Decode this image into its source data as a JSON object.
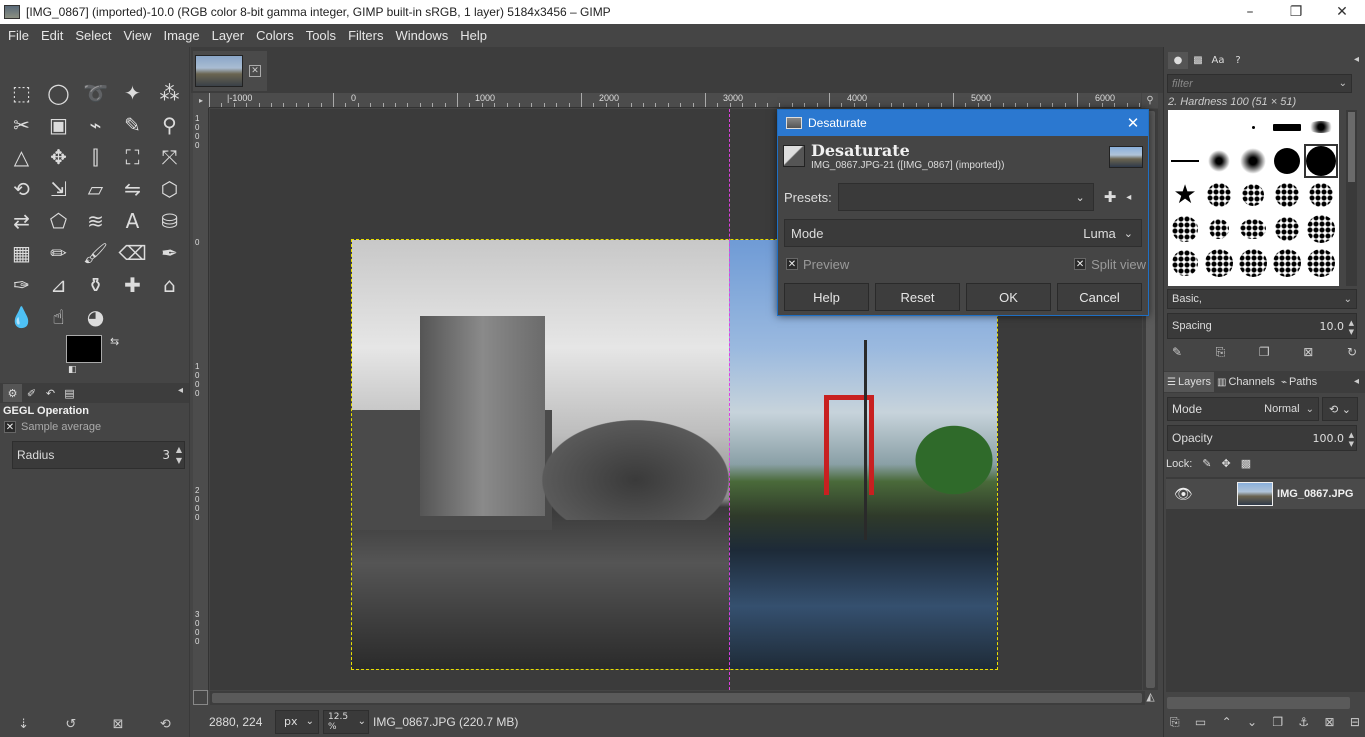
{
  "window": {
    "title": "[IMG_0867] (imported)-10.0 (RGB color 8-bit gamma integer, GIMP built-in sRGB, 1 layer) 5184x3456 – GIMP",
    "buttons": [
      "–",
      "❐",
      "✕"
    ]
  },
  "menu": [
    "File",
    "Edit",
    "Select",
    "View",
    "Image",
    "Layer",
    "Colors",
    "Tools",
    "Filters",
    "Windows",
    "Help"
  ],
  "toolbox": {
    "tools": [
      {
        "name": "rect-select-icon",
        "glyph": "⬚"
      },
      {
        "name": "ellipse-select-icon",
        "glyph": "◯"
      },
      {
        "name": "free-select-icon",
        "glyph": "➰"
      },
      {
        "name": "fuzzy-select-icon",
        "glyph": "✦"
      },
      {
        "name": "select-by-color-icon",
        "glyph": "⁂"
      },
      {
        "name": "scissors-select-icon",
        "glyph": "✂"
      },
      {
        "name": "foreground-select-icon",
        "glyph": "▣"
      },
      {
        "name": "paths-icon",
        "glyph": "⌁"
      },
      {
        "name": "color-picker-icon",
        "glyph": "✎"
      },
      {
        "name": "zoom-icon",
        "glyph": "⚲"
      },
      {
        "name": "measure-icon",
        "glyph": "△"
      },
      {
        "name": "move-icon",
        "glyph": "✥"
      },
      {
        "name": "align-icon",
        "glyph": "⫿"
      },
      {
        "name": "crop-icon",
        "glyph": "⛶"
      },
      {
        "name": "unified-transform-icon",
        "glyph": "⤧"
      },
      {
        "name": "rotate-icon",
        "glyph": "⟲"
      },
      {
        "name": "scale-icon",
        "glyph": "⇲"
      },
      {
        "name": "shear-icon",
        "glyph": "▱"
      },
      {
        "name": "flip-icon",
        "glyph": "⇋"
      },
      {
        "name": "perspective-icon",
        "glyph": "⬡"
      },
      {
        "name": "warp-transform-icon",
        "glyph": "⇄"
      },
      {
        "name": "cage-transform-icon",
        "glyph": "⬠"
      },
      {
        "name": "smudge-warp-icon",
        "glyph": "≋"
      },
      {
        "name": "text-icon",
        "glyph": "A"
      },
      {
        "name": "bucket-fill-icon",
        "glyph": "⛁"
      },
      {
        "name": "gradient-icon",
        "glyph": "▦"
      },
      {
        "name": "pencil-icon",
        "glyph": "✏"
      },
      {
        "name": "paintbrush-icon",
        "glyph": "🖌"
      },
      {
        "name": "eraser-icon",
        "glyph": "⌫"
      },
      {
        "name": "airbrush-icon",
        "glyph": "✒"
      },
      {
        "name": "ink-icon",
        "glyph": "✑"
      },
      {
        "name": "mypaint-brush-icon",
        "glyph": "⊿"
      },
      {
        "name": "clone-icon",
        "glyph": "⚱"
      },
      {
        "name": "heal-icon",
        "glyph": "✚"
      },
      {
        "name": "perspective-clone-icon",
        "glyph": "⌂"
      },
      {
        "name": "blur-icon",
        "glyph": "💧"
      },
      {
        "name": "smudge-icon",
        "glyph": "☝"
      },
      {
        "name": "dodge-burn-icon",
        "glyph": "◕"
      }
    ],
    "options_title": "GEGL Operation",
    "sample_average": "Sample average",
    "radius_label": "Radius",
    "radius_value": "3",
    "bottom_icons": [
      "⇣",
      "↺",
      "⊠",
      "⟲"
    ]
  },
  "rulers": {
    "h_labels": [
      "|-1000",
      "0",
      "1000",
      "2000",
      "3000",
      "4000",
      "5000",
      "6000"
    ],
    "v_labels": [
      "1000",
      "0",
      "1000",
      "2000",
      "3000"
    ]
  },
  "status": {
    "coords": "2880, 224",
    "unit": "px",
    "zoom": "12.5 %",
    "file": "IMG_0867.JPG (220.7 MB)"
  },
  "dialog": {
    "window_title": "Desaturate",
    "heading": "Desaturate",
    "subtitle": "IMG_0867.JPG-21 ([IMG_0867] (imported))",
    "presets_label": "Presets:",
    "presets_value": "",
    "mode_label": "Mode",
    "mode_value": "Luma",
    "preview_label": "Preview",
    "split_view_label": "Split view",
    "buttons": {
      "help": "Help",
      "reset": "Reset",
      "ok": "OK",
      "cancel": "Cancel"
    }
  },
  "brushes": {
    "filter_placeholder": "filter",
    "current_brush": "2. Hardness 100 (51 × 51)",
    "brush_set": "Basic,",
    "spacing_label": "Spacing",
    "spacing_value": "10.0"
  },
  "layers": {
    "tabs": [
      "Layers",
      "Channels",
      "Paths"
    ],
    "mode_label": "Mode",
    "mode_value": "Normal",
    "opacity_label": "Opacity",
    "opacity_value": "100.0",
    "lock_label": "Lock:",
    "layer_name": "IMG_0867.JPG"
  },
  "colors": {
    "accent": "#2b78d0",
    "selection_marching_ants": "#e8e000",
    "split_guide": "#e040e0"
  }
}
